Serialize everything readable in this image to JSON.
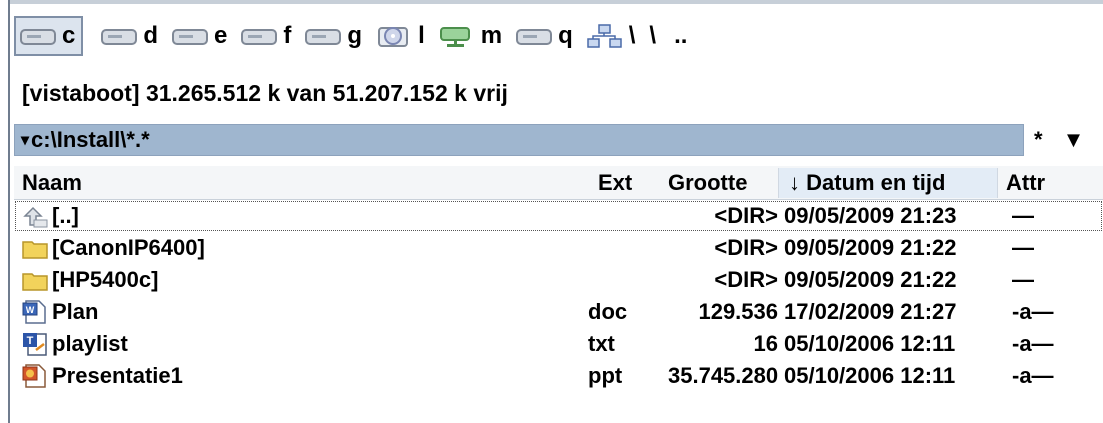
{
  "drives": [
    {
      "letter": "c",
      "icon": "hard-drive-icon",
      "active": true
    },
    {
      "letter": "d",
      "icon": "hard-drive-icon",
      "active": false
    },
    {
      "letter": "e",
      "icon": "hard-drive-icon",
      "active": false
    },
    {
      "letter": "f",
      "icon": "hard-drive-icon",
      "active": false
    },
    {
      "letter": "g",
      "icon": "hard-drive-icon",
      "active": false
    },
    {
      "letter": "l",
      "icon": "cd-drive-icon",
      "active": false
    },
    {
      "letter": "m",
      "icon": "network-drive-icon",
      "active": false
    },
    {
      "letter": "q",
      "icon": "hard-drive-icon",
      "active": false
    }
  ],
  "drivebar_extra": {
    "network": "\\",
    "root": "\\",
    "up": ".."
  },
  "freespace": "[vistaboot]  31.265.512 k van 51.207.152 k vrij",
  "path": {
    "arrow": "▾",
    "text": "c:\\Install\\*.*",
    "star": "*",
    "dropdown": "▼"
  },
  "columns": {
    "name": "Naam",
    "ext": "Ext",
    "size": "Grootte",
    "date_arrow": "↓",
    "date": "Datum en tijd",
    "attr": "Attr"
  },
  "files": [
    {
      "icon": "up-folder-icon",
      "name": "[..]",
      "ext": "",
      "size": "<DIR>",
      "date": "09/05/2009 21:23",
      "attr": "—"
    },
    {
      "icon": "folder-icon",
      "name": "[CanonIP6400]",
      "ext": "",
      "size": "<DIR>",
      "date": "09/05/2009 21:22",
      "attr": "—"
    },
    {
      "icon": "folder-icon",
      "name": "[HP5400c]",
      "ext": "",
      "size": "<DIR>",
      "date": "09/05/2009 21:22",
      "attr": "—"
    },
    {
      "icon": "word-doc-icon",
      "name": "Plan",
      "ext": "doc",
      "size": "129.536",
      "date": "17/02/2009 21:27",
      "attr": "-a—"
    },
    {
      "icon": "text-file-icon",
      "name": "playlist",
      "ext": "txt",
      "size": "16",
      "date": "05/10/2006 12:11",
      "attr": "-a—"
    },
    {
      "icon": "powerpoint-icon",
      "name": "Presentatie1",
      "ext": "ppt",
      "size": "35.745.280",
      "date": "05/10/2006 12:11",
      "attr": "-a—"
    }
  ],
  "colors": {
    "pathbar": "#9fb6cf",
    "header": "#f4f6f8",
    "folder": "#f2d35b"
  }
}
